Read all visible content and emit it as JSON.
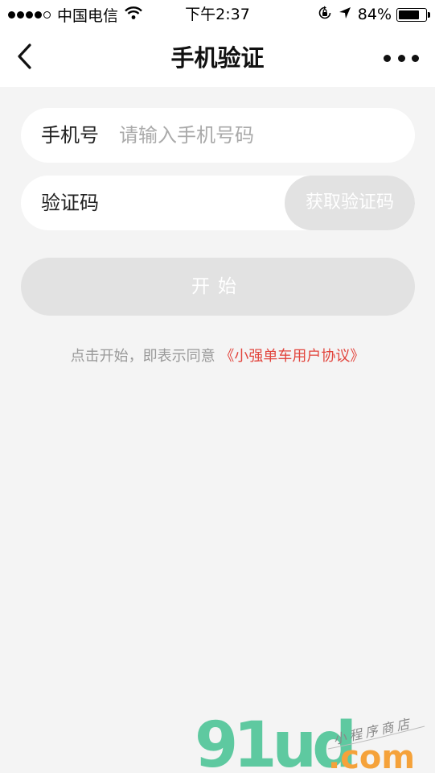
{
  "status_bar": {
    "carrier": "中国电信",
    "time": "下午2:37",
    "battery_percent": "84%",
    "battery_level": 0.84,
    "icons": [
      "signal-dots-icon",
      "wifi-icon",
      "orientation-lock-icon",
      "location-arrow-icon",
      "battery-icon"
    ]
  },
  "nav": {
    "title": "手机验证",
    "back_icon": "chevron-left-icon",
    "more_icon": "more-dots-icon"
  },
  "form": {
    "phone_label": "手机号",
    "phone_placeholder": "请输入手机号码",
    "phone_value": "",
    "code_label": "验证码",
    "code_value": "",
    "get_code_button": "获取验证码",
    "start_button": "开始"
  },
  "agreement": {
    "prefix": "点击开始，即表示同意",
    "link": "《小强单车用户协议》"
  },
  "watermark": {
    "logo": "91ud",
    "domain": ".com",
    "tagline": "小程序商店"
  },
  "colors": {
    "background": "#f4f4f4",
    "button_disabled": "#e2e2e2",
    "link": "#e2453d",
    "watermark_green": "#5ec9a0",
    "watermark_orange": "#f5a23a"
  }
}
